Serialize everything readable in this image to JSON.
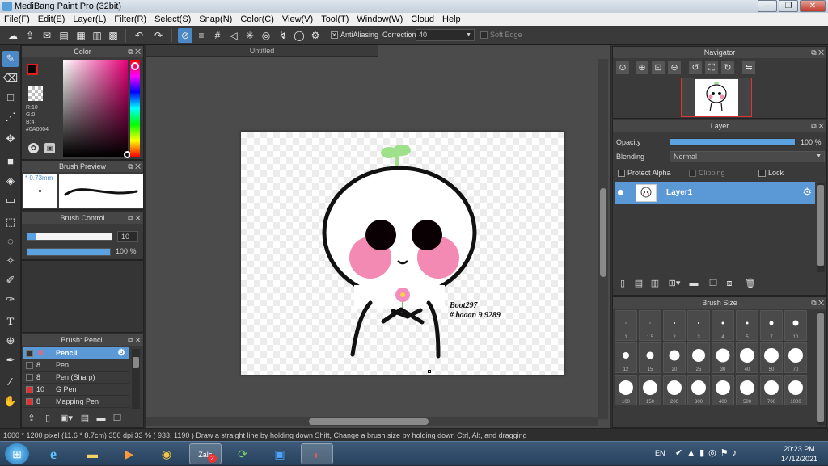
{
  "window": {
    "title": "MediBang Paint Pro (32bit)"
  },
  "menu": [
    "File(F)",
    "Edit(E)",
    "Layer(L)",
    "Filter(R)",
    "Select(S)",
    "Snap(N)",
    "Color(C)",
    "View(V)",
    "Tool(T)",
    "Window(W)",
    "Cloud",
    "Help"
  ],
  "toolbar": {
    "antialiasing_label": "AntiAliasing",
    "correction_label": "Correction",
    "correction_value": "40",
    "soft_edge_label": "Soft Edge"
  },
  "color_panel": {
    "title": "Color",
    "r": "R:10",
    "g": "G:0",
    "b": "B:4",
    "hex": "#0A0004",
    "current_color": "#0a0004"
  },
  "brush_preview": {
    "title": "Brush Preview",
    "size": "* 0.73mm"
  },
  "brush_control": {
    "title": "Brush Control",
    "size_value": "10",
    "size_fraction": 0.1,
    "opacity_value": "100 %",
    "opacity_fraction": 1.0
  },
  "brush_list": {
    "title": "Brush: Pencil",
    "items": [
      {
        "size": "10",
        "name": "Pencil",
        "color": "#333333",
        "selected": true
      },
      {
        "size": "8",
        "name": "Pen",
        "color": "#333333"
      },
      {
        "size": "8",
        "name": "Pen (Sharp)",
        "color": "#333333"
      },
      {
        "size": "10",
        "name": "G Pen",
        "color": "#e03030"
      },
      {
        "size": "8",
        "name": "Mapping Pen",
        "color": "#e03030"
      }
    ]
  },
  "document": {
    "tab_title": "Untitled",
    "signature_line1": "Boot297",
    "signature_line2": "# baaan 9 9289"
  },
  "navigator": {
    "title": "Navigator"
  },
  "layer_panel": {
    "title": "Layer",
    "opacity_label": "Opacity",
    "opacity_value": "100 %",
    "opacity_fraction": 1.0,
    "blending_label": "Blending",
    "blending_value": "Normal",
    "protect_alpha_label": "Protect Alpha",
    "clipping_label": "Clipping",
    "lock_label": "Lock",
    "layers": [
      {
        "name": "Layer1"
      }
    ]
  },
  "brush_size": {
    "title": "Brush Size",
    "sizes": [
      "1",
      "1.5",
      "2",
      "3",
      "4",
      "5",
      "7",
      "10",
      "12",
      "15",
      "20",
      "25",
      "30",
      "40",
      "50",
      "70",
      "100",
      "150",
      "200",
      "300",
      "400",
      "500",
      "700",
      "1000"
    ]
  },
  "status": {
    "dimensions": "1600 * 1200 pixel",
    "physical": "(11.6 * 8.7cm)",
    "dpi": "350 dpi",
    "zoom": "33 %",
    "coords": "( 933, 1190 )",
    "hint": "Draw a straight line by holding down Shift, Change a brush size by holding down Ctrl, Alt, and dragging"
  },
  "taskbar": {
    "language": "EN",
    "time": "20:23 PM",
    "date": "14/12/2021",
    "zalo_label": "Zalo",
    "zalo_badge": "2"
  }
}
